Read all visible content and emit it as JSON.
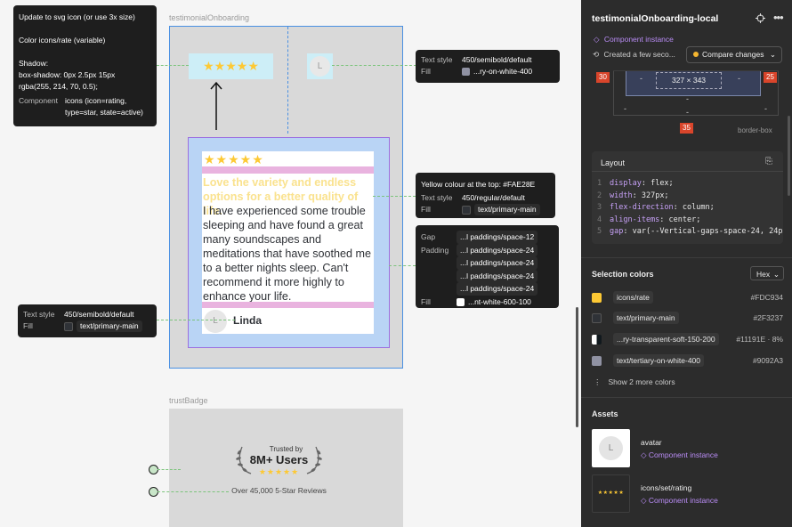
{
  "canvas": {
    "frame1_label": "testimonialOnboarding",
    "frame2_label": "trustBadge",
    "note_top": {
      "line1": "Update to svg icon (or use 3x size)",
      "line2": "Color icons/rate (variable)",
      "line3": "Shadow:",
      "line4": "box-shadow: 0px 2.5px 15px",
      "line5": "rgba(255, 214, 70, 0.5);",
      "component_key": "Component",
      "component_val": "icons (icon=rating,",
      "component_val2": "type=star, state=active)"
    },
    "note_avatar": {
      "text_style_key": "Text style",
      "text_style_val": "450/semibold/default",
      "fill_key": "Fill",
      "fill_val": "...ry-on-white-400",
      "fill_color": "#9092a3"
    },
    "note_quote": {
      "line1": "Yellow colour at the top: #FAE28E",
      "text_style_key": "Text style",
      "text_style_val": "450/regular/default",
      "fill_key": "Fill",
      "fill_val": "text/primary-main",
      "fill_color": "#2f3237"
    },
    "note_gap": {
      "gap_key": "Gap",
      "gap_val": "...l paddings/space-12",
      "padding_key": "Padding",
      "padding_vals": [
        "...l paddings/space-24",
        "...l paddings/space-24",
        "...l paddings/space-24",
        "...l paddings/space-24"
      ],
      "fill_key": "Fill",
      "fill_val": "...nt-white-600-100",
      "fill_color": "#ffffff"
    },
    "note_name": {
      "text_style_key": "Text style",
      "text_style_val": "450/semibold/default",
      "fill_key": "Fill",
      "fill_val": "text/primary-main",
      "fill_color": "#2f3237"
    },
    "card": {
      "stars": "★★★★★",
      "top_stars": "★★★★★",
      "quote": "Love the variety and endless options for a better quality of life.",
      "body": "I have experienced some trouble sleeping and have found a great many soundscapes and meditations that have soothed me to a better nights sleep. Can't recommend it more highly to enhance your life.",
      "avatar_letter": "L",
      "name": "Linda",
      "small_avatar_letter": "L"
    },
    "badge": {
      "trusted_by": "Trusted by",
      "users": "8M+ Users",
      "stars": "★★★★★",
      "reviews": "Over 45,000 5-Star Reviews"
    }
  },
  "panel": {
    "title": "testimonialOnboarding-local",
    "component_instance": "Component instance",
    "created": "Created a few seco...",
    "compare": "Compare changes",
    "box": {
      "left": "30",
      "right": "25",
      "bottom": "35",
      "size": "327 × 343",
      "dash": "-",
      "label": "border-box"
    },
    "layout": {
      "title": "Layout",
      "lines": [
        {
          "n": "1",
          "prop": "display",
          "val": "flex;"
        },
        {
          "n": "2",
          "prop": "width",
          "val": "327px;"
        },
        {
          "n": "3",
          "prop": "flex-direction",
          "val": "column;"
        },
        {
          "n": "4",
          "prop": "align-items",
          "val": "center;"
        },
        {
          "n": "5",
          "prop": "gap",
          "val": "var(--Vertical-gaps-space-24, 24px"
        }
      ]
    },
    "selection_colors": {
      "title": "Selection colors",
      "format": "Hex",
      "items": [
        {
          "name": "icons/rate",
          "hex": "#FDC934",
          "color": "#fdc934"
        },
        {
          "name": "text/primary-main",
          "hex": "#2F3237",
          "color": "#2f3237"
        },
        {
          "name": "...ry-transparent-soft-150-200",
          "hex": "#11191E · 8%",
          "color": "#11191e"
        },
        {
          "name": "text/tertiary-on-white-400",
          "hex": "#9092A3",
          "color": "#9092a3"
        }
      ],
      "show_more": "Show 2 more colors"
    },
    "assets": {
      "title": "Assets",
      "items": [
        {
          "name": "avatar",
          "sub": "Component instance",
          "letter": "L"
        },
        {
          "name": "icons/set/rating",
          "sub": "Component instance",
          "stars": "★★★★★"
        }
      ]
    }
  }
}
